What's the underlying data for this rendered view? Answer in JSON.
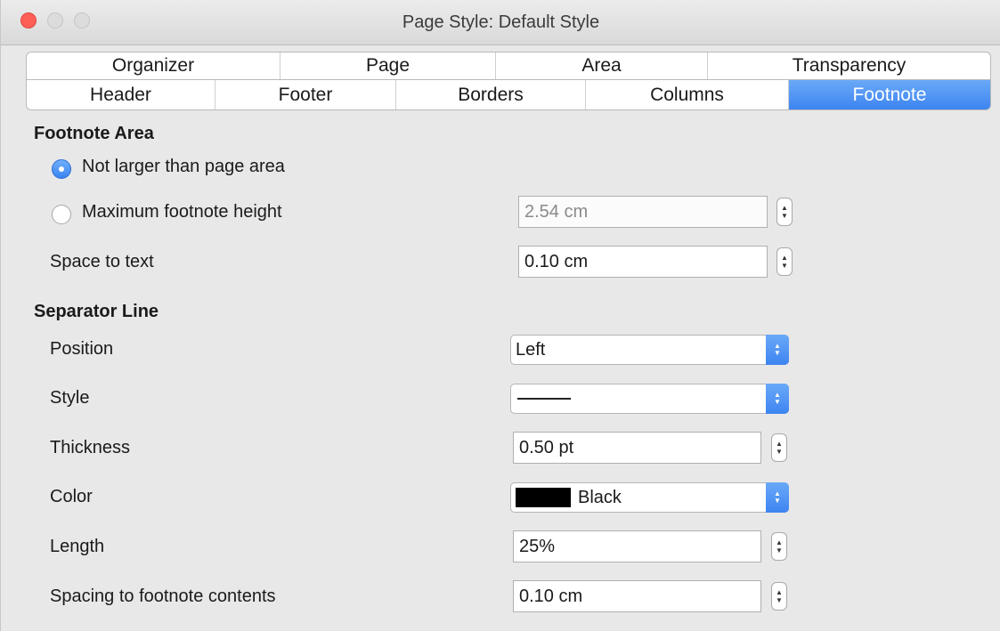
{
  "window": {
    "title": "Page Style: Default Style"
  },
  "tabs_row1": [
    {
      "label": "Organizer"
    },
    {
      "label": "Page"
    },
    {
      "label": "Area"
    },
    {
      "label": "Transparency"
    }
  ],
  "tabs_row2": [
    {
      "label": "Header"
    },
    {
      "label": "Footer"
    },
    {
      "label": "Borders"
    },
    {
      "label": "Columns"
    },
    {
      "label": "Footnote",
      "active": true
    }
  ],
  "footnote_area": {
    "heading": "Footnote Area",
    "option_not_larger": "Not larger than page area",
    "option_max_height": "Maximum footnote height",
    "max_height_value": "2.54 cm",
    "space_to_text_label": "Space to text",
    "space_to_text_value": "0.10 cm",
    "selected_option": "not_larger"
  },
  "separator_line": {
    "heading": "Separator Line",
    "position_label": "Position",
    "position_value": "Left",
    "style_label": "Style",
    "thickness_label": "Thickness",
    "thickness_value": "0.50 pt",
    "color_label": "Color",
    "color_value": "Black",
    "color_hex": "#000000",
    "length_label": "Length",
    "length_value": "25%",
    "spacing_label": "Spacing to footnote contents",
    "spacing_value": "0.10 cm"
  },
  "colors": {
    "accent": "#3d84f1",
    "close_button": "#fd5f57"
  }
}
